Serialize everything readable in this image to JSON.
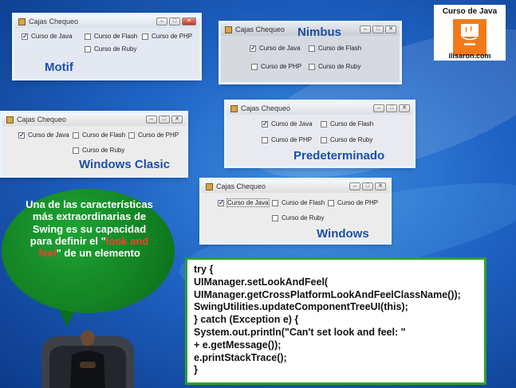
{
  "window_title": "Cajas Chequeo",
  "checkboxes": {
    "java": "Curso de Java",
    "flash": "Curso de Flash",
    "php": "Curso de PHP",
    "ruby": "Curso de Ruby"
  },
  "laf_names": {
    "motif": "Motif",
    "nimbus": "Nimbus",
    "windows_classic": "Windows Clasic",
    "default": "Predeterminado",
    "windows": "Windows"
  },
  "logo": {
    "title": "Curso de Java",
    "website": "ilisaron.com"
  },
  "bubble": {
    "text_before": "Una de las características más extraordinarias de Swing es su capacidad para definir el \"",
    "highlight": "look and feel",
    "text_after": "\" de un elemento"
  },
  "code_lines": [
    "try {",
    "UIManager.setLookAndFeel(",
    "UIManager.getCrossPlatformLookAndFeelClassName());",
    "SwingUtilities.updateComponentTreeUI(this);",
    "} catch (Exception e) {",
    "System.out.println(\"Can't set look and feel: \"",
    "+ e.getMessage());",
    "e.printStackTrace();",
    "}"
  ],
  "colors": {
    "laf_label": "#1b4fa8",
    "bubble": "#0f8a22",
    "code_border": "#2ca02c",
    "highlight": "#ff3b2f"
  }
}
